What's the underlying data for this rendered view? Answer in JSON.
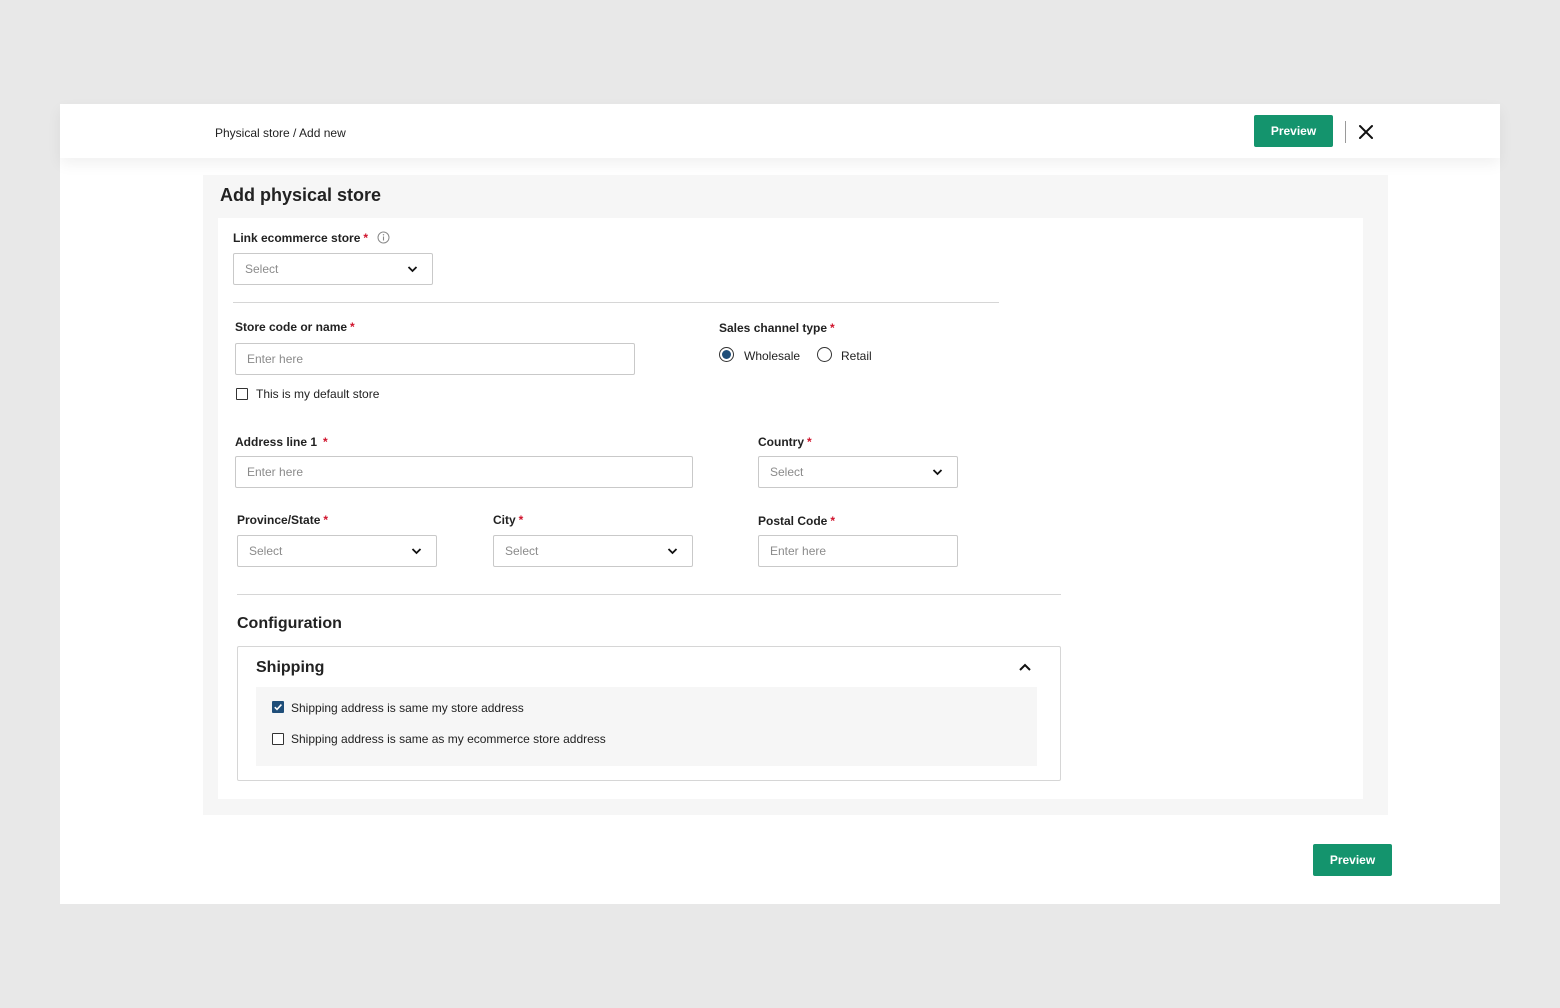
{
  "header": {
    "breadcrumb": "Physical store / Add new",
    "preview_label": "Preview"
  },
  "page": {
    "title": "Add physical store"
  },
  "form": {
    "link_store": {
      "label": "Link ecommerce store",
      "placeholder": "Select"
    },
    "store_code": {
      "label": "Store code or name",
      "placeholder": "Enter here"
    },
    "default_store": {
      "label": "This is my default store",
      "checked": false
    },
    "sales_channel": {
      "label": "Sales channel type",
      "options": [
        {
          "label": "Wholesale",
          "selected": true
        },
        {
          "label": "Retail",
          "selected": false
        }
      ]
    },
    "address1": {
      "label": "Address line 1",
      "placeholder": "Enter here"
    },
    "country": {
      "label": "Country",
      "placeholder": "Select"
    },
    "province": {
      "label": "Province/State",
      "placeholder": "Select"
    },
    "city": {
      "label": "City",
      "placeholder": "Select"
    },
    "postal": {
      "label": "Postal Code",
      "placeholder": "Enter here"
    },
    "required_mark": "*"
  },
  "configuration": {
    "title": "Configuration",
    "shipping": {
      "title": "Shipping",
      "options": [
        {
          "label": "Shipping address is same my store address",
          "checked": true
        },
        {
          "label": "Shipping address is same as my ecommerce store address",
          "checked": false
        }
      ]
    }
  },
  "footer": {
    "preview_label": "Preview"
  },
  "colors": {
    "primary": "#14946d",
    "required": "#d0132c",
    "selected": "#1f4e79"
  }
}
